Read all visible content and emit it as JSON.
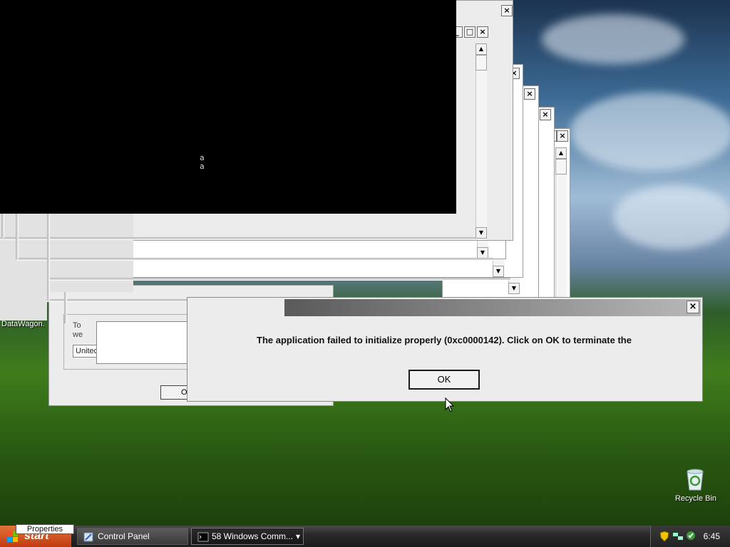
{
  "desktop": {
    "datawagon_label": "DataWagon.",
    "recycle_bin_label": "Recycle Bin"
  },
  "console": {
    "lines": [
      "a",
      "a"
    ]
  },
  "background_window": {
    "tab_fragments": [
      "To",
      "we"
    ],
    "list_fragment": "Unitec",
    "button_fragment": "O"
  },
  "dialog": {
    "message": "The application failed to initialize properly (0xc0000142). Click on OK to terminate the",
    "ok_label": "OK",
    "close_glyph": "×"
  },
  "window_controls": {
    "close_glyph": "×",
    "maximize_glyph": "□",
    "minimize_glyph": "_",
    "scroll_up_glyph": "▲",
    "scroll_down_glyph": "▼"
  },
  "taskbar": {
    "start_label": "start",
    "tooltip": "Properties",
    "items": [
      {
        "label": "Control Panel"
      },
      {
        "label": "58 Windows Comm...",
        "dropdown_glyph": "▾"
      }
    ],
    "clock": "6:45"
  },
  "colors": {
    "console_bg": "#000000",
    "dialog_bg": "#ececec",
    "taskbar": "#1c1c1c",
    "start_button": "#c23a10"
  }
}
